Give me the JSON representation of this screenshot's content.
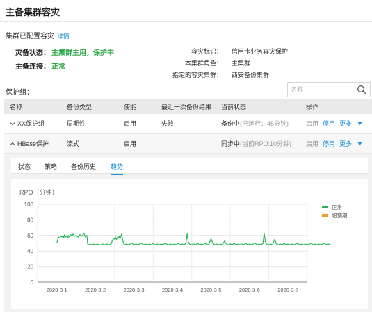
{
  "page": {
    "title": "主备集群容灾"
  },
  "summary": {
    "text": "集群已配置容灾",
    "link": "详情..."
  },
  "status": [
    {
      "label": "灾备状态：",
      "value": "主集群主用，保护中"
    },
    {
      "label": "主备连接：",
      "value": "正常"
    }
  ],
  "info": [
    {
      "label": "容灾标识：",
      "value": "信用卡业务容灾保护"
    },
    {
      "label": "本集群角色：",
      "value": "主集群"
    },
    {
      "label": "指定的容灾集群：",
      "value": "西安备份集群"
    }
  ],
  "protection_group": {
    "label": "保护组：",
    "search_placeholder": "名称"
  },
  "table": {
    "headers": [
      "名称",
      "备份类型",
      "使能",
      "最近一次备份结果",
      "当前状态",
      "操作"
    ],
    "rows": [
      {
        "name": "XX保护组",
        "type": "周期性",
        "enable": "启用",
        "result": "失败",
        "state": "备份中",
        "state_detail": "(已运行：45分钟)",
        "op_enable": "启用",
        "op_disable": "停用",
        "op_more": "更多"
      },
      {
        "name": "HBase保护",
        "type": "流式",
        "enable": "启用",
        "result": "",
        "state": "同步中",
        "state_detail": "(当前RPO:10分钟)",
        "op_enable": "启用",
        "op_disable": "停用",
        "op_more": "更多"
      }
    ]
  },
  "detail_tabs": [
    "状态",
    "策略",
    "备份历史",
    "趋势"
  ],
  "active_tab": "趋势",
  "chart_data": {
    "type": "line",
    "ylabel": "RPO（分钟）",
    "ylim": [
      0,
      100
    ],
    "yticks": [
      "0",
      "20",
      "40",
      "60",
      "80",
      "100"
    ],
    "xticks": [
      "2020-3-1",
      "2020-3-2",
      "2020-3-3",
      "2020-3-4",
      "2020-3-5",
      "2020-3-6",
      "2020-3-7"
    ],
    "legend": [
      {
        "name": "正常",
        "color": "#2ab45a"
      },
      {
        "name": "超预期",
        "color": "#f29630"
      }
    ],
    "series": [
      {
        "name": "正常",
        "color": "#2ab45a",
        "x": [
          0,
          0.04,
          0.08,
          0.1,
          0.13,
          0.16,
          0.18,
          0.2,
          0.23,
          0.26,
          0.29,
          0.3,
          0.33,
          0.36,
          0.4,
          0.43,
          0.46,
          0.5,
          0.55,
          0.6,
          0.65,
          0.7,
          0.74,
          0.78,
          0.8,
          0.83,
          0.86,
          0.9,
          0.95,
          1.0,
          1.05,
          1.1,
          1.15,
          1.2,
          1.25,
          1.3,
          1.35,
          1.4,
          1.42,
          1.44,
          1.46,
          1.5,
          1.52,
          1.54,
          1.56,
          1.58,
          1.6,
          1.62,
          1.64,
          1.66,
          1.68,
          1.7,
          1.72,
          1.74,
          1.76,
          1.8,
          1.85,
          1.9,
          1.95,
          2.0,
          2.05,
          2.1,
          2.15,
          2.2,
          2.25,
          2.3,
          2.35,
          2.4,
          2.45,
          2.5,
          2.55,
          2.6,
          2.65,
          2.7,
          2.75,
          2.8,
          2.85,
          2.9,
          2.95,
          3.0,
          3.05,
          3.1,
          3.15,
          3.2,
          3.25,
          3.3,
          3.35,
          3.38,
          3.41,
          3.44,
          3.5,
          3.55,
          3.6,
          3.65,
          3.7,
          3.75,
          3.8,
          3.85,
          3.9,
          3.95,
          4.0,
          4.05,
          4.1,
          4.15,
          4.2,
          4.25,
          4.3,
          4.35,
          4.4,
          4.45,
          4.5,
          4.55,
          4.6,
          4.65,
          4.7,
          4.75,
          4.8,
          4.85,
          4.9,
          4.95,
          5.0,
          5.05,
          5.1,
          5.15,
          5.2,
          5.25,
          5.3,
          5.35,
          5.38,
          5.41,
          5.44,
          5.5,
          5.55,
          5.6,
          5.65,
          5.7,
          5.75,
          5.8,
          5.85,
          5.9,
          5.95,
          6.0,
          6.05,
          6.1,
          6.15,
          6.2,
          6.25,
          6.3,
          6.35,
          6.4,
          6.45,
          6.5,
          6.55,
          6.6,
          6.65,
          6.7,
          6.75,
          6.8,
          6.85,
          6.9,
          6.95,
          7.0,
          7.05,
          7.1
        ],
        "values": [
          50,
          58,
          57,
          59,
          58,
          60,
          57,
          61,
          58,
          59,
          57,
          60,
          58,
          61,
          60,
          62,
          59,
          60,
          58,
          61,
          59,
          63,
          58,
          60,
          49,
          48,
          49,
          48,
          49,
          48,
          49,
          48,
          48,
          49,
          48,
          49,
          48,
          49,
          50,
          54,
          55,
          56,
          58,
          55,
          56,
          58,
          57,
          59,
          56,
          58,
          62,
          57,
          52,
          49,
          48,
          49,
          48,
          49,
          50,
          48,
          49,
          48,
          49,
          50,
          48,
          49,
          48,
          49,
          48,
          50,
          48,
          49,
          48,
          49,
          48,
          50,
          49,
          48,
          49,
          48,
          49,
          48,
          50,
          48,
          49,
          48,
          50,
          62,
          52,
          49,
          48,
          49,
          48,
          50,
          48,
          49,
          48,
          50,
          48,
          49,
          56,
          50,
          48,
          49,
          48,
          49,
          48,
          53,
          49,
          48,
          49,
          48,
          50,
          48,
          49,
          48,
          49,
          48,
          50,
          48,
          49,
          48,
          49,
          50,
          48,
          49,
          48,
          50,
          63,
          52,
          49,
          48,
          49,
          48,
          55,
          49,
          48,
          49,
          48,
          50,
          48,
          49,
          48,
          49,
          48,
          49,
          50,
          48,
          49,
          48,
          49,
          48,
          49,
          50,
          48,
          49,
          48,
          49,
          48,
          49,
          50,
          48,
          49,
          48
        ]
      }
    ]
  }
}
